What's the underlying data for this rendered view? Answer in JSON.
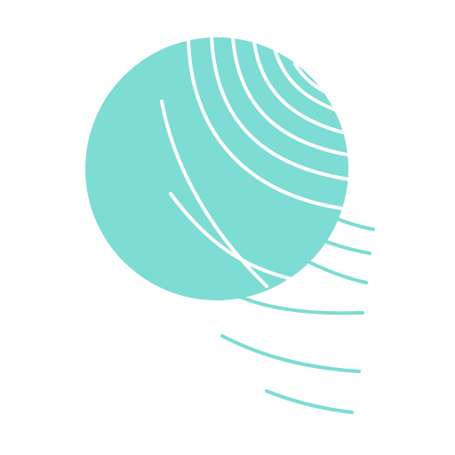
{
  "logo": {
    "icon": "teal-sphere-with-concentric-arcs-logo",
    "fill_color": "#7ddcd3",
    "line_color": "#ffffff"
  }
}
